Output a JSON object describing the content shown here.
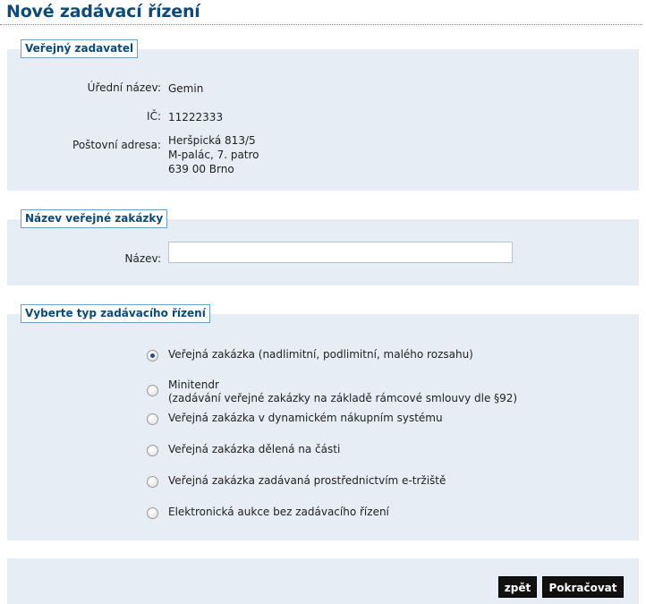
{
  "page": {
    "title": "Nové zadávací řízení"
  },
  "contracting_authority": {
    "legend": "Veřejný zadavatel",
    "official_name_label": "Úřední název:",
    "official_name": "Gemin",
    "ic_label": "IČ:",
    "ic": "11222333",
    "address_label": "Poštovní adresa:",
    "address_line1": "Heršpická 813/5",
    "address_line2": "M-palác, 7. patro",
    "address_line3": "639 00 Brno"
  },
  "contract_name": {
    "legend": "Název veřejné zakázky",
    "name_label": "Název:",
    "name_value": ""
  },
  "procedure_type": {
    "legend": "Vyberte typ zadávacího řízení",
    "options": [
      {
        "label": "Veřejná zakázka (nadlimitní, podlimitní, malého rozsahu)",
        "checked": true
      },
      {
        "label": "Minitendr",
        "sublabel": "(zadávání veřejné zakázky na základě rámcové smlouvy dle §92)",
        "checked": false
      },
      {
        "label": "Veřejná zakázka v dynamickém nákupním systému",
        "checked": false
      },
      {
        "label": "Veřejná zakázka dělená na části",
        "checked": false
      },
      {
        "label": "Veřejná zakázka zadávaná prostřednictvím e-tržiště",
        "checked": false
      },
      {
        "label": "Elektronická aukce bez zadávacího řízení",
        "checked": false
      }
    ]
  },
  "actions": {
    "back_label": "zpět",
    "continue_label": "Pokračovat"
  },
  "colors": {
    "title": "#0b4a7a",
    "panel": "#e6edf4",
    "legend_border": "#6a9fc6",
    "button": "#111111"
  }
}
